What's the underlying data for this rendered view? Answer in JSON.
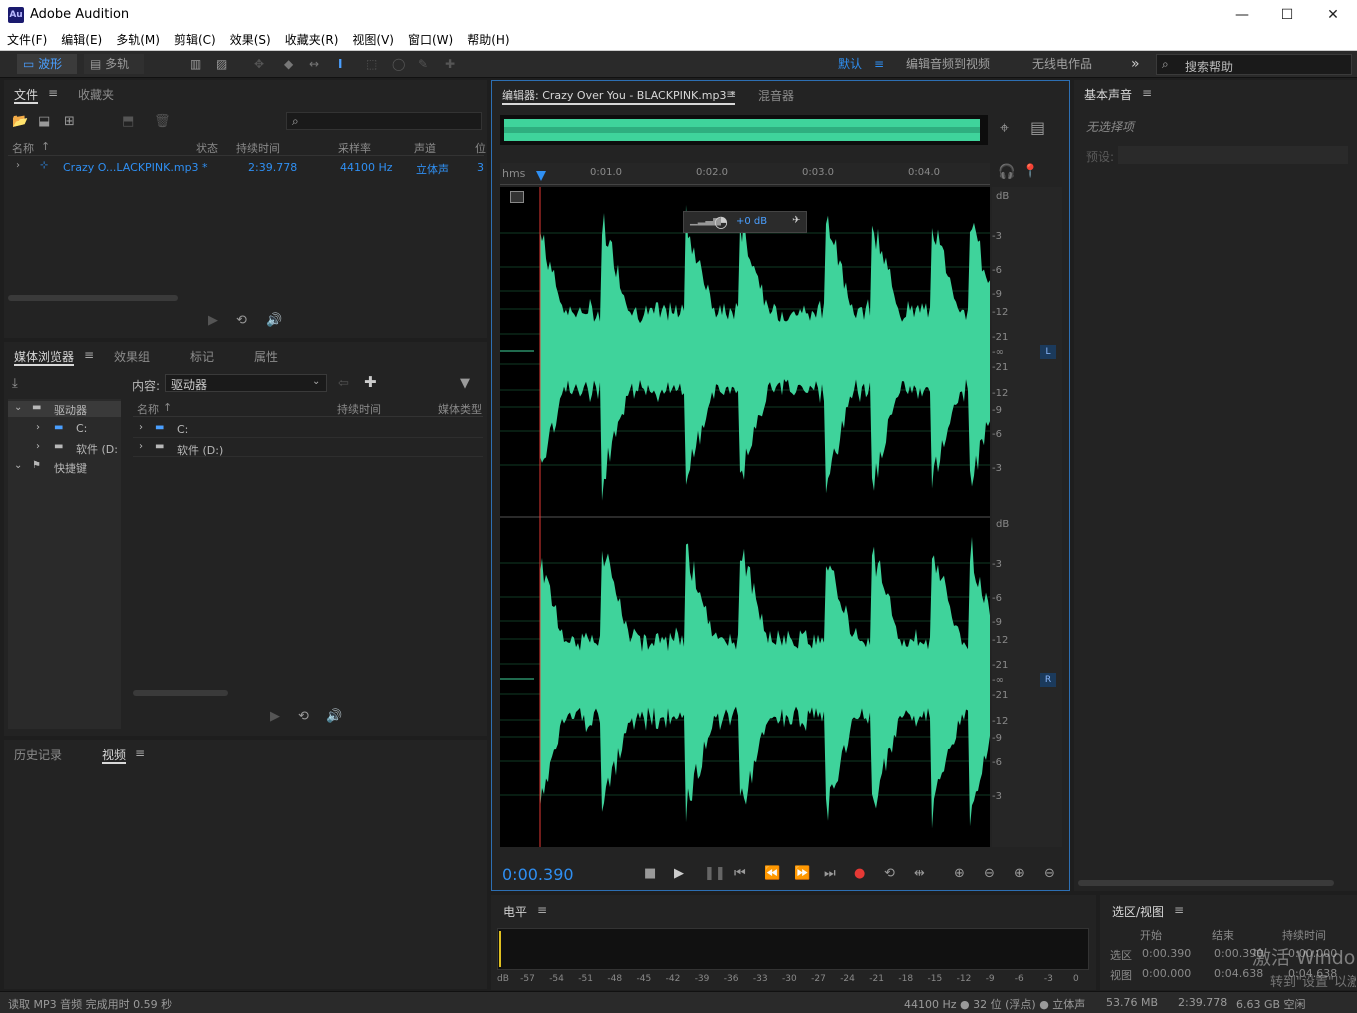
{
  "window": {
    "title": "Adobe Audition",
    "logo": "Au",
    "minimize": "—",
    "maximize": "☐",
    "close": "✕"
  },
  "menu": [
    "文件(F)",
    "编辑(E)",
    "多轨(M)",
    "剪辑(C)",
    "效果(S)",
    "收藏夹(R)",
    "视图(V)",
    "窗口(W)",
    "帮助(H)"
  ],
  "toolbar": {
    "waveform": "波形",
    "multitrack": "多轨",
    "workspaces": [
      "默认",
      "编辑音频到视频",
      "无线电作品"
    ],
    "more": "»",
    "search_placeholder": "搜索帮助"
  },
  "files_panel": {
    "tabs": [
      "文件",
      "收藏夹"
    ],
    "columns": [
      "名称",
      "状态",
      "持续时间",
      "采样率",
      "声道",
      "位"
    ],
    "rows": [
      {
        "name": "Crazy O...LACKPINK.mp3 *",
        "duration": "2:39.778",
        "rate": "44100 Hz",
        "channels": "立体声",
        "bits": "3"
      }
    ]
  },
  "media_panel": {
    "tabs": [
      "媒体浏览器",
      "效果组",
      "标记",
      "属性"
    ],
    "content_label": "内容:",
    "content_value": "驱动器",
    "tree": [
      "驱动器",
      "C:",
      "软件 (D:",
      "快捷键"
    ],
    "columns": [
      "名称",
      "持续时间",
      "媒体类型"
    ],
    "rows": [
      "C:",
      "软件 (D:)"
    ]
  },
  "lower_left": {
    "tabs": [
      "历史记录",
      "视频"
    ]
  },
  "editor": {
    "tab": "编辑器: Crazy Over You - BLACKPINK.mp3 *",
    "tab2": "混音器",
    "ruler_unit": "hms",
    "ruler_ticks": [
      "0:01.0",
      "0:02.0",
      "0:03.0",
      "0:04.0"
    ],
    "hud_gain": "+0 dB",
    "db_scale": [
      "dB",
      "-3",
      "-6",
      "-9",
      "-12",
      "-21",
      "-∞",
      "-21",
      "-12",
      "-9",
      "-6",
      "-3"
    ],
    "channel_l": "L",
    "channel_r": "R",
    "time": "0:00.390"
  },
  "essential_sound": {
    "tab": "基本声音",
    "no_selection": "无选择项",
    "preset": "预设:"
  },
  "level_panel": {
    "tab": "电平",
    "scale": [
      "dB",
      "-57",
      "-54",
      "-51",
      "-48",
      "-45",
      "-42",
      "-39",
      "-36",
      "-33",
      "-30",
      "-27",
      "-24",
      "-21",
      "-18",
      "-15",
      "-12",
      "-9",
      "-6",
      "-3",
      "0"
    ]
  },
  "selection_panel": {
    "tab": "选区/视图",
    "headers": [
      "开始",
      "结束",
      "持续时间"
    ],
    "rows": [
      {
        "label": "选区",
        "start": "0:00.390",
        "end": "0:00.390",
        "duration": "0:00.000"
      },
      {
        "label": "视图",
        "start": "0:00.000",
        "end": "0:04.638",
        "duration": "0:04.638"
      }
    ],
    "watermark1": "激活 Windo",
    "watermark2": "转到\"设置\"以激"
  },
  "status": {
    "left": "读取 MP3 音频 完成用时 0.59 秒",
    "format": "44100 Hz ● 32 位 (浮点) ● 立体声",
    "size": "53.76 MB",
    "duration": "2:39.778",
    "free": "6.63 GB 空闲"
  }
}
